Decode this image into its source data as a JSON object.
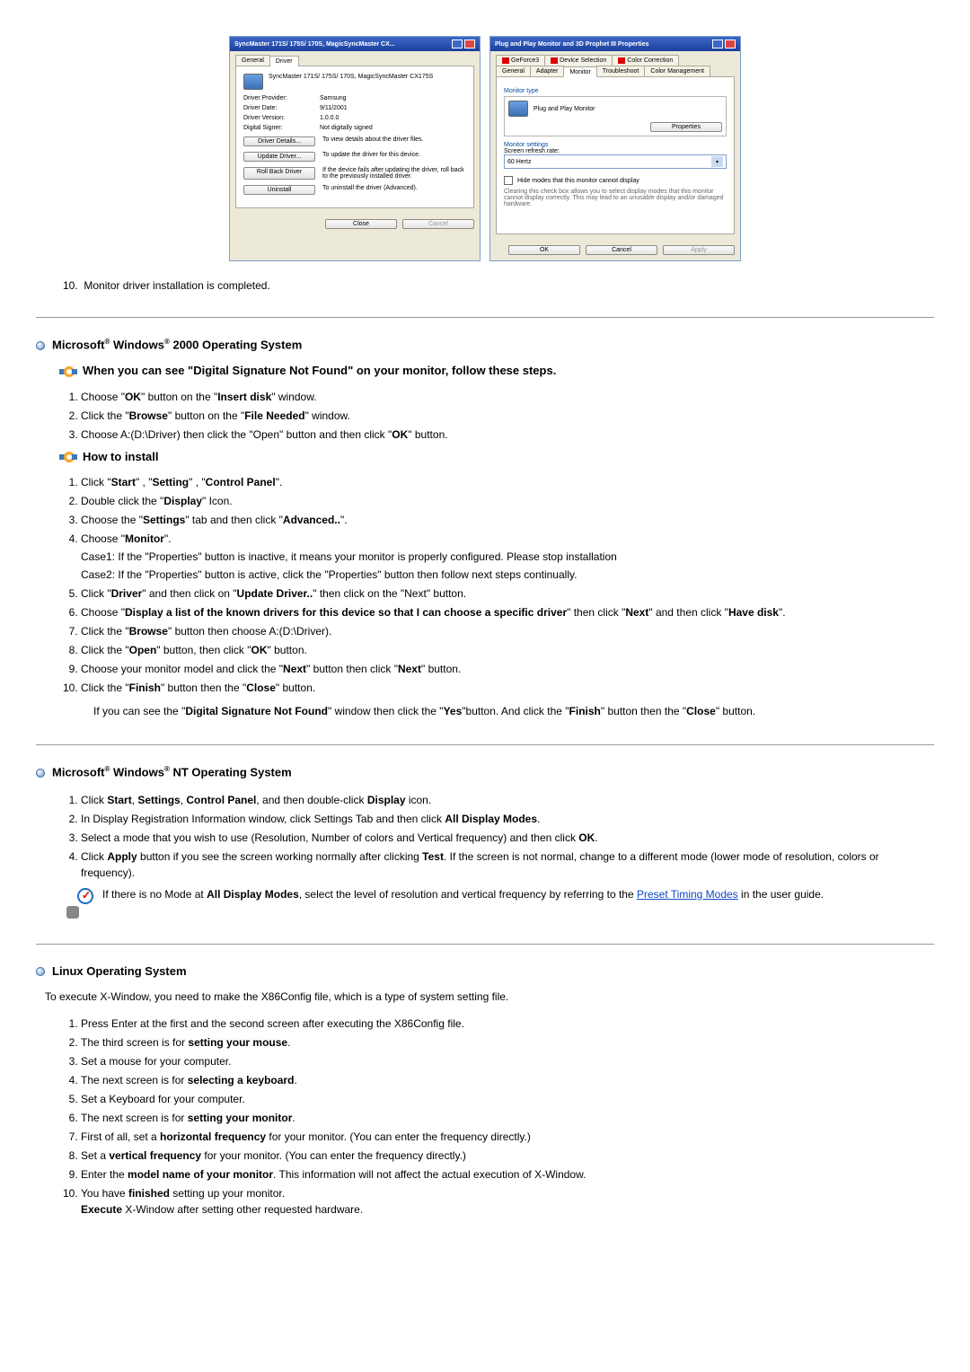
{
  "win1": {
    "title": "SyncMaster 171S/ 175S/ 170S, MagicSyncMaster CX...",
    "tabs": {
      "general": "General",
      "driver": "Driver"
    },
    "heading": "SyncMaster 171S/ 175S/ 170S, MagicSyncMaster CX175S",
    "rows": {
      "providerL": "Driver Provider:",
      "provider": "Samsung",
      "dateL": "Driver Date:",
      "date": "9/11/2001",
      "versionL": "Driver Version:",
      "version": "1.0.0.0",
      "signerL": "Digital Signer:",
      "signer": "Not digitally signed"
    },
    "btns": {
      "details": "Driver Details...",
      "detailsTxt": "To view details about the driver files.",
      "update": "Update Driver...",
      "updateTxt": "To update the driver for this device.",
      "rollback": "Roll Back Driver",
      "rollbackTxt": "If the device fails after updating the driver, roll back to the previously installed driver.",
      "uninstall": "Uninstall",
      "uninstallTxt": "To uninstall the driver (Advanced)."
    },
    "footer": {
      "close": "Close",
      "cancel": "Cancel"
    }
  },
  "win2": {
    "title": "Plug and Play Monitor and 3D Prophet III Properties",
    "tabsTop": {
      "geforce": "GeForce3",
      "device": "Device Selection",
      "color": "Color Correction"
    },
    "tabsBot": {
      "general": "General",
      "adapter": "Adapter",
      "monitor": "Monitor",
      "trouble": "Troubleshoot",
      "colormgmt": "Color Management"
    },
    "monType": "Monitor type",
    "monName": "Plug and Play Monitor",
    "prop": "Properties",
    "monSet": "Monitor settings",
    "refresh": "Screen refresh rate:",
    "rate": "60 Hertz",
    "hide": "Hide modes that this monitor cannot display",
    "hideTxt": "Clearing this check box allows you to select display modes that this monitor cannot display correctly. This may lead to an unusable display and/or damaged hardware.",
    "footer": {
      "ok": "OK",
      "cancel": "Cancel",
      "apply": "Apply"
    }
  },
  "stepDone": "Monitor driver installation is completed.",
  "win2000": {
    "h": "Microsoft® Windows® 2000 Operating System",
    "sub1": "When you can see \"Digital Signature Not Found\" on your monitor, follow these steps.",
    "a1": "Choose \"OK\" button on the \"Insert disk\" window.",
    "a2": "Click the \"Browse\" button on the \"File Needed\" window.",
    "a3": "Choose A:(D:\\Driver) then click the \"Open\" button and then click \"OK\" button.",
    "sub2": "How to install",
    "b1": "Click \"Start\" , \"Setting\" , \"Control Panel\".",
    "b2": "Double click the \"Display\" Icon.",
    "b3": "Choose the \"Settings\" tab and then click \"Advanced..\".",
    "b4": "Choose \"Monitor\".",
    "b4c1": "Case1: If the \"Properties\" button is inactive, it means your monitor is properly configured. Please stop installation",
    "b4c2": "Case2: If the \"Properties\" button is active, click the \"Properties\" button then follow next steps continually.",
    "b5": "Click \"Driver\" and then click on \"Update Driver..\" then click on the \"Next\" button.",
    "b6": "Choose \"Display a list of the known drivers for this device so that I can choose a specific driver\" then click \"Next\" and then click \"Have disk\".",
    "b7": "Click the \"Browse\" button then choose A:(D:\\Driver).",
    "b8": "Click the \"Open\" button, then click \"OK\" button.",
    "b9": "Choose your monitor model and click the \"Next\" button then click \"Next\" button.",
    "b10": "Click the \"Finish\" button then the \"Close\" button.",
    "end": "If you can see the \"Digital Signature Not Found\" window then click the \"Yes\"button. And click the \"Finish\" button then the \"Close\" button."
  },
  "nt": {
    "h": "Microsoft® Windows® NT Operating System",
    "s1": "Click Start, Settings, Control Panel, and then double-click Display icon.",
    "s2": "In Display Registration Information window, click Settings Tab and then click All Display Modes.",
    "s3": "Select a mode that you wish to use (Resolution, Number of colors and Vertical frequency) and then click OK.",
    "s4": "Click Apply button if you see the screen working normally after clicking Test. If the screen is not normal, change to a different mode (lower mode of resolution, colors or frequency).",
    "noteA": "If there is no Mode at All Display Modes, select the level of resolution and vertical frequency by referring to the ",
    "noteLink": "Preset Timing Modes",
    "noteB": " in the user guide."
  },
  "linux": {
    "h": "Linux Operating System",
    "intro": "To execute X-Window, you need to make the X86Config file, which is a type of system setting file.",
    "s1": "Press Enter at the first and the second screen after executing the X86Config file.",
    "s2": "The third screen is for setting your mouse.",
    "s3": "Set a mouse for your computer.",
    "s4": "The next screen is for selecting a keyboard.",
    "s5": "Set a Keyboard for your computer.",
    "s6": "The next screen is for setting your monitor.",
    "s7": "First of all, set a horizontal frequency for your monitor. (You can enter the frequency directly.)",
    "s8": "Set a vertical frequency for your monitor. (You can enter the frequency directly.)",
    "s9": "Enter the model name of your monitor. This information will not affect the actual execution of X-Window.",
    "s10a": "You have finished setting up your monitor.",
    "s10b": "Execute X-Window after setting other requested hardware."
  }
}
